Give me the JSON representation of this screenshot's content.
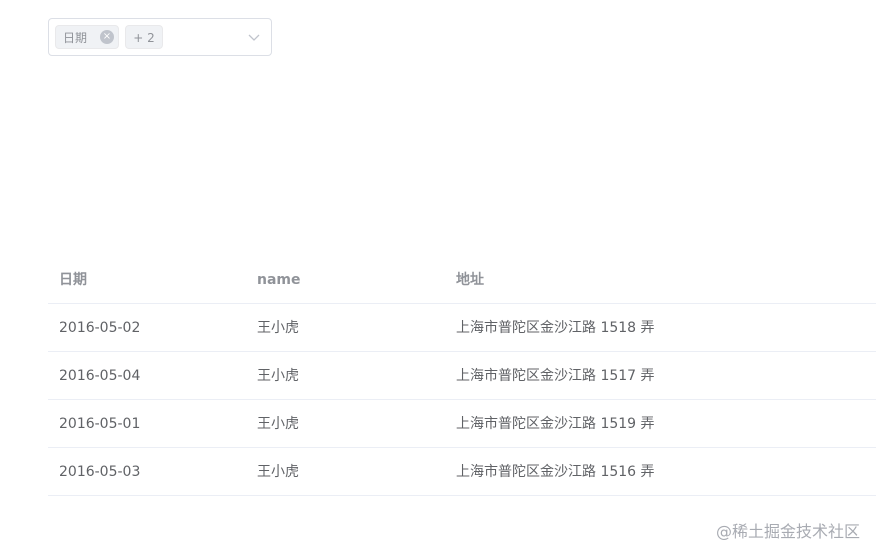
{
  "select": {
    "tag_label": "日期",
    "tag_count": "+ 2",
    "close_glyph": "×",
    "icons": [
      "close-icon",
      "chevron-down-icon"
    ]
  },
  "table": {
    "headers": [
      "日期",
      "name",
      "地址"
    ],
    "rows": [
      [
        "2016-05-02",
        "王小虎",
        "上海市普陀区金沙江路 1518 弄"
      ],
      [
        "2016-05-04",
        "王小虎",
        "上海市普陀区金沙江路 1517 弄"
      ],
      [
        "2016-05-01",
        "王小虎",
        "上海市普陀区金沙江路 1519 弄"
      ],
      [
        "2016-05-03",
        "王小虎",
        "上海市普陀区金沙江路 1516 弄"
      ]
    ]
  },
  "watermark": "@稀土掘金技术社区"
}
